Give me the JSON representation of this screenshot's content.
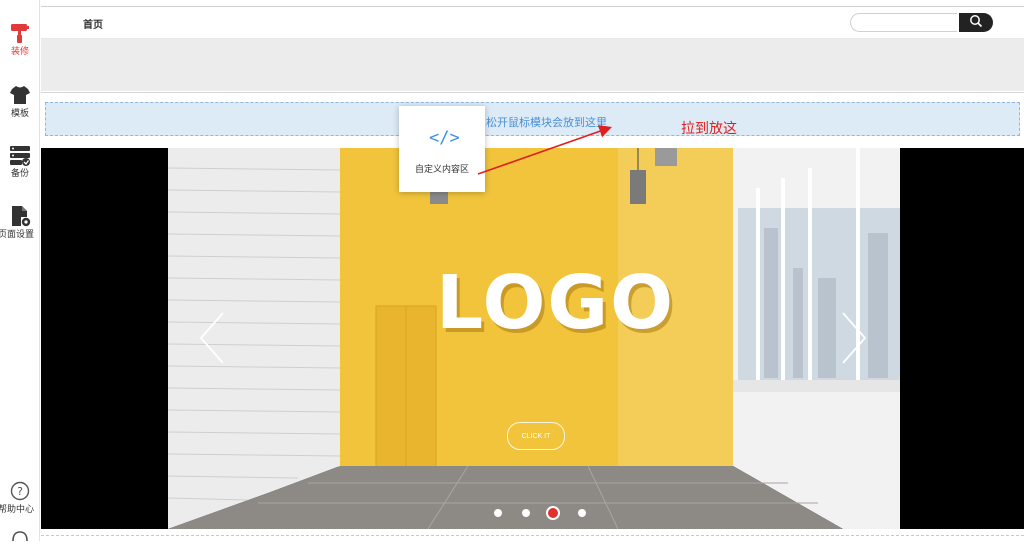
{
  "sidebar": {
    "items": [
      {
        "label": "装修",
        "icon": "paint-roller-icon",
        "active": true
      },
      {
        "label": "模板",
        "icon": "tshirt-icon"
      },
      {
        "label": "备份",
        "icon": "backup-icon"
      },
      {
        "label": "页面设置",
        "icon": "page-settings-icon"
      }
    ],
    "help": {
      "label": "帮助中心",
      "icon": "help-icon"
    },
    "support_icon": "headset-icon"
  },
  "header": {
    "nav_home": "首页",
    "search": {
      "value": "",
      "placeholder": "",
      "icon": "search-icon"
    }
  },
  "drop_zone": {
    "hint": "松开鼠标模块会放到这里"
  },
  "drag_card": {
    "icon": "code-icon",
    "label": "自定义内容区"
  },
  "annotation": {
    "text": "拉到放这",
    "color": "#e02020"
  },
  "banner": {
    "logo_text": "LOGO",
    "button_label": "CLICK IT",
    "slides_count": 4,
    "active_slide": 3,
    "prev_icon": "chevron-left-icon",
    "next_icon": "chevron-right-icon"
  },
  "colors": {
    "accent_red": "#e03a3a",
    "drop_zone_bg": "#ddebf7",
    "drop_zone_text": "#4a8fd4",
    "wall_yellow": "#f2c23a",
    "search_button": "#222222"
  }
}
